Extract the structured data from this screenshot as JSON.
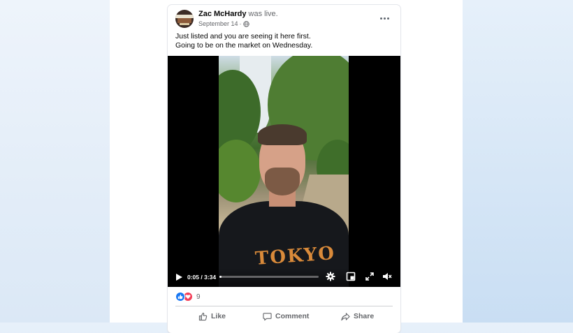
{
  "post": {
    "author": "Zac McHardy",
    "action": "was live.",
    "date": "September 14",
    "separator": "·",
    "privacy_icon": "globe-icon",
    "text_lines": [
      "Just listed and you are seeing it here first.",
      "Going to be on the market on Wednesday."
    ]
  },
  "video": {
    "shirt_text": "TOKYO",
    "time_label": "0:05 / 3:34",
    "progress_fraction": 0.023,
    "controls": [
      "play-icon",
      "settings-icon",
      "mini-player-icon",
      "fullscreen-icon",
      "mute-icon"
    ]
  },
  "reactions": {
    "types": [
      "like-icon",
      "love-icon"
    ],
    "count": "9"
  },
  "actions": {
    "like": "Like",
    "comment": "Comment",
    "share": "Share"
  },
  "colors": {
    "accent_blue": "#1877f2",
    "love_red": "#f33e58",
    "meta_grey": "#65676b"
  }
}
